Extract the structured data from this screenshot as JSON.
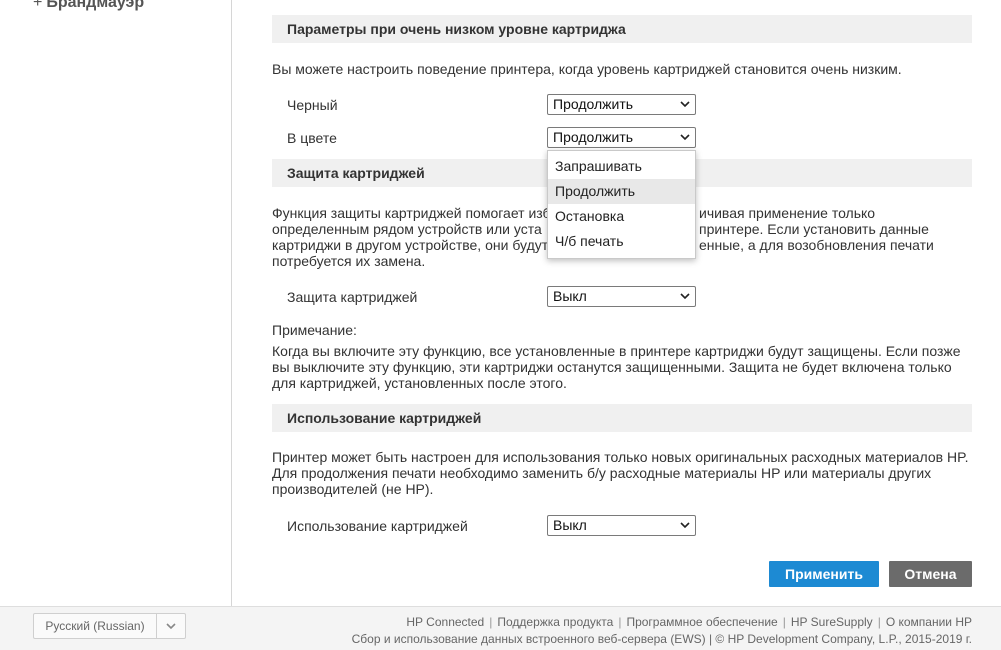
{
  "sidebar": {
    "items": [
      {
        "prefix": "+",
        "label": "Брандмауэр"
      }
    ]
  },
  "sections": {
    "low_cartridge": {
      "title": "Параметры при очень низком уровне картриджа",
      "description": "Вы можете настроить поведение принтера, когда уровень картриджей становится очень низким.",
      "black_label": "Черный",
      "black_value": "Продолжить",
      "color_label": "В цвете",
      "color_value": "Продолжить"
    },
    "protection": {
      "title": "Защита картриджей",
      "description_lines": [
        "Функция защиты картриджей помогает изб",
        "ичивая применение только",
        "определенным рядом устройств или уста",
        "принтере. Если установить данные",
        "картриджи в другом устройстве, они будут",
        "енные, а для возобновления печати",
        "потребуется их замена."
      ],
      "setting_label": "Защита картриджей",
      "setting_value": "Выкл",
      "note_title": "Примечание:",
      "note_lines": [
        "Когда вы включите эту функцию, все установленные в принтере картриджи будут защищены. Если позже",
        "вы выключите эту функцию, эти картриджи останутся защищенными. Защита не будет включена только",
        "для картриджей, установленных после этого."
      ]
    },
    "usage": {
      "title": "Использование картриджей",
      "description_lines": [
        "Принтер может быть настроен для использования только новых оригинальных расходных материалов HP.",
        "Для продолжения печати необходимо заменить б/у расходные материалы HP или материалы других",
        "производителей (не HP)."
      ],
      "setting_label": "Использование картриджей",
      "setting_value": "Выкл"
    }
  },
  "dropdown": {
    "options": [
      "Запрашивать",
      "Продолжить",
      "Остановка",
      "Ч/б печать"
    ],
    "highlighted": "Продолжить"
  },
  "buttons": {
    "apply": "Применить",
    "cancel": "Отмена"
  },
  "footer": {
    "language": "Русский (Russian)",
    "links": [
      "HP Connected",
      "Поддержка продукта",
      "Программное обеспечение",
      "HP SureSupply",
      "О компании HP"
    ],
    "copyright": "Сбор и использование данных встроенного веб-сервера (EWS) | © HP Development Company, L.P., 2015-2019 г."
  },
  "icons": {
    "select_chevron": "chevron-down-icon",
    "language_chevron": "chevron-down-icon"
  },
  "colors": {
    "apply_button": "#1d8ad3",
    "cancel_button": "#6b6b6b",
    "section_header_bg": "#f0f0f0"
  }
}
